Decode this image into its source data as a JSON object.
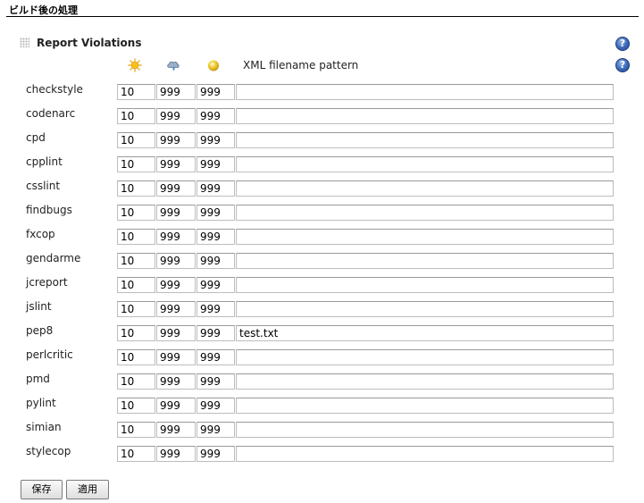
{
  "section": {
    "title": "ビルド後の処理"
  },
  "plugin": {
    "title": "Report Violations"
  },
  "help": {
    "glyph": "?"
  },
  "columns": {
    "icons": [
      "sun-icon",
      "storm-cloud-icon",
      "yellow-ball-icon"
    ],
    "pattern_header": "XML filename pattern"
  },
  "rows": [
    {
      "name": "checkstyle",
      "min": "10",
      "max": "999",
      "unstable": "999",
      "pattern": ""
    },
    {
      "name": "codenarc",
      "min": "10",
      "max": "999",
      "unstable": "999",
      "pattern": ""
    },
    {
      "name": "cpd",
      "min": "10",
      "max": "999",
      "unstable": "999",
      "pattern": ""
    },
    {
      "name": "cpplint",
      "min": "10",
      "max": "999",
      "unstable": "999",
      "pattern": ""
    },
    {
      "name": "csslint",
      "min": "10",
      "max": "999",
      "unstable": "999",
      "pattern": ""
    },
    {
      "name": "findbugs",
      "min": "10",
      "max": "999",
      "unstable": "999",
      "pattern": ""
    },
    {
      "name": "fxcop",
      "min": "10",
      "max": "999",
      "unstable": "999",
      "pattern": ""
    },
    {
      "name": "gendarme",
      "min": "10",
      "max": "999",
      "unstable": "999",
      "pattern": ""
    },
    {
      "name": "jcreport",
      "min": "10",
      "max": "999",
      "unstable": "999",
      "pattern": ""
    },
    {
      "name": "jslint",
      "min": "10",
      "max": "999",
      "unstable": "999",
      "pattern": ""
    },
    {
      "name": "pep8",
      "min": "10",
      "max": "999",
      "unstable": "999",
      "pattern": "test.txt"
    },
    {
      "name": "perlcritic",
      "min": "10",
      "max": "999",
      "unstable": "999",
      "pattern": ""
    },
    {
      "name": "pmd",
      "min": "10",
      "max": "999",
      "unstable": "999",
      "pattern": ""
    },
    {
      "name": "pylint",
      "min": "10",
      "max": "999",
      "unstable": "999",
      "pattern": ""
    },
    {
      "name": "simian",
      "min": "10",
      "max": "999",
      "unstable": "999",
      "pattern": ""
    },
    {
      "name": "stylecop",
      "min": "10",
      "max": "999",
      "unstable": "999",
      "pattern": ""
    }
  ],
  "buttons": {
    "save": "保存",
    "apply": "適用"
  },
  "colors": {
    "help_blue": "#3a66b7",
    "sun": "#f6c21b",
    "cloud": "#7f97b5",
    "ball": "#f2d23c"
  }
}
